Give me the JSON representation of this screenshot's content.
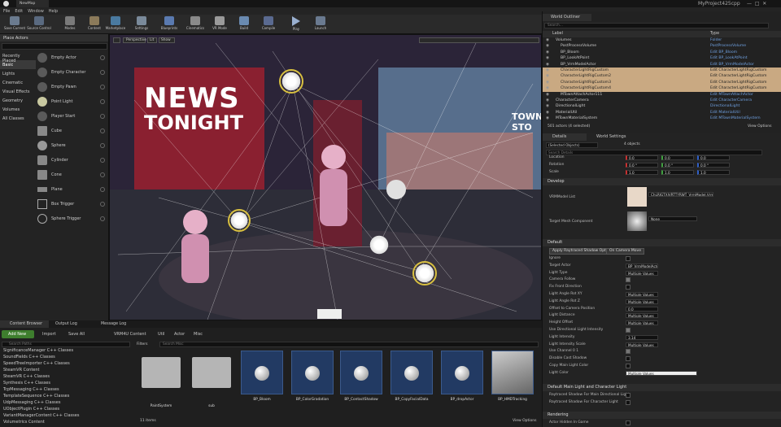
{
  "window": {
    "project": "MyProject425cpp",
    "tab": "NewMap"
  },
  "menu": [
    "File",
    "Edit",
    "Window",
    "Help"
  ],
  "toolbar": [
    "Save Current",
    "Source Control",
    "Modes",
    "Content",
    "Marketplace",
    "Settings",
    "Blueprints",
    "Cinematics",
    "VR Mode",
    "Build",
    "Compile",
    "Play",
    "Launch"
  ],
  "place_actors": {
    "tab": "Place Actors",
    "search_placeholder": "",
    "categories": [
      "Recently Placed",
      "Basic",
      "Lights",
      "Cinematic",
      "Visual Effects",
      "Geometry",
      "Volumes",
      "All Classes"
    ],
    "actors": [
      "Empty Actor",
      "Empty Character",
      "Empty Pawn",
      "Point Light",
      "Player Start",
      "Cube",
      "Sphere",
      "Cylinder",
      "Cone",
      "Plane",
      "Box Trigger",
      "Sphere Trigger"
    ]
  },
  "viewport": {
    "perspective": "Perspective",
    "lit": "Lit",
    "show": "Show",
    "sign_line1": "NEWS",
    "sign_line2": "TONIGHT",
    "side_sign": "TOWN STO"
  },
  "content_browser": {
    "tabs": [
      "Content Browser",
      "Output Log",
      "Message Log"
    ],
    "add_new": "Add New",
    "import": "Import",
    "save_all": "Save All",
    "path": [
      "VRM4U Content",
      "Util",
      "Actor",
      "Misc"
    ],
    "search_paths": "Search Paths",
    "filters": "Filters",
    "search_misc": "Search Misc",
    "tree": [
      "SignificanceManager C++ Classes",
      "SoundFields C++ Classes",
      "SpeedTreeImporter C++ Classes",
      "SteamVR Content",
      "SteamVR C++ Classes",
      "Synthesis C++ Classes",
      "TcpMessaging C++ Classes",
      "TemplateSequence C++ Classes",
      "UdpMessaging C++ Classes",
      "UObjectPlugin C++ Classes",
      "VariantManagerContent C++ Classes",
      "Volumetrics Content"
    ],
    "assets": [
      "PaintSystem",
      "sub",
      "BP_Bloom",
      "BP_ColorGradation",
      "BP_ContactShadow",
      "BP_CopyFacialData",
      "BP_dropActor",
      "BP_HMDTracking"
    ],
    "count": "11 items",
    "view_options": "View Options"
  },
  "outliner": {
    "tab": "World Outliner",
    "search_placeholder": "Search...",
    "col_label": "Label",
    "col_type": "Type",
    "rows": [
      {
        "label": "Volumes",
        "type": "Folder"
      },
      {
        "label": "PostProcessVolume",
        "type": "PostProcessVolume"
      },
      {
        "label": "BP_Bloom",
        "type": "Edit BP_Bloom"
      },
      {
        "label": "BP_LookAtPoint",
        "type": "Edit BP_LookAtPoint"
      },
      {
        "label": "BP_VrmModelActor",
        "type": "Edit BP_VrmModelActor"
      },
      {
        "label": "CharacterLightRigCustom",
        "type": "Edit CharacterLightRigCustom"
      },
      {
        "label": "CharacterLightRigCustom2",
        "type": "Edit CharacterLightRigCustom"
      },
      {
        "label": "CharacterLightRigCustom3",
        "type": "Edit CharacterLightRigCustom"
      },
      {
        "label": "CharacterLightRigCustom4",
        "type": "Edit CharacterLightRigCustom"
      },
      {
        "label": "MTownAttachActor111",
        "type": "Edit MTownAttachActor"
      },
      {
        "label": "CharacterCamera",
        "type": "Edit CharacterCamera"
      },
      {
        "label": "DirectionalLight",
        "type": "DirectionalLight"
      },
      {
        "label": "MaterialUtil",
        "type": "Edit MaterialUtil"
      },
      {
        "label": "MTownMaterialSystem",
        "type": "Edit MTownMaterialSystem"
      }
    ],
    "status": "501 actors (4 selected)",
    "view_options": "View Options"
  },
  "details": {
    "tabs": [
      "Details",
      "World Settings"
    ],
    "selected": "(Selected Objects)",
    "count": "4 objects",
    "search_placeholder": "Search Details",
    "transform": [
      {
        "label": "Location",
        "x": "0.0",
        "y": "0.0",
        "z": "0.0"
      },
      {
        "label": "Rotation",
        "x": "0.0 °",
        "y": "0.0 °",
        "z": "0.0 °"
      },
      {
        "label": "Scale",
        "x": "1.0",
        "y": "1.0",
        "z": "1.0"
      }
    ],
    "develop": "Develop",
    "vrm_model_list": "VRMModel List",
    "vrm_model_value": "ChLRIGTXIVRTTYRWT_VrmModel.VrmModel",
    "target_mesh": "Target Mesh Component",
    "target_mesh_value": "None",
    "default": "Default",
    "apply_button": "Apply Raytraced Shadow Option",
    "camera_move_button": "On Camera Move",
    "props": [
      {
        "label": "Ignore",
        "kind": "check",
        "on": false
      },
      {
        "label": "Target Actor",
        "kind": "value",
        "value": "BP_VrmModelActor"
      },
      {
        "label": "Light Type",
        "kind": "value",
        "value": "Multiple Values"
      },
      {
        "label": "Camera Follow",
        "kind": "check",
        "on": true
      },
      {
        "label": "Fix Front Direction",
        "kind": "check",
        "on": false
      },
      {
        "label": "Light Angle Rot XY",
        "kind": "value",
        "value": "Multiple Values"
      },
      {
        "label": "Light Angle Rot Z",
        "kind": "value",
        "value": "Multiple Values"
      },
      {
        "label": "Offset to Camera Position",
        "kind": "value",
        "value": "0.0"
      },
      {
        "label": "Light Distance",
        "kind": "value",
        "value": "Multiple Values"
      },
      {
        "label": "Height Offset",
        "kind": "value",
        "value": "Multiple Values"
      },
      {
        "label": "Use Directional Light Intensity",
        "kind": "check",
        "on": true
      },
      {
        "label": "Light Intensity",
        "kind": "value",
        "value": "3.14"
      },
      {
        "label": "Light Intensity Scale",
        "kind": "value",
        "value": "Multiple Values"
      },
      {
        "label": "Use Channel 0 1",
        "kind": "check",
        "on": true
      },
      {
        "label": "Disable Cast Shadow",
        "kind": "check",
        "on": false
      },
      {
        "label": "Copy Main Light Color",
        "kind": "check",
        "on": false
      },
      {
        "label": "Light Color",
        "kind": "value",
        "value": "Multiple Values"
      }
    ],
    "section_main_light": "Default Main Light and Character Light",
    "raytrace_props": [
      "Raytraced Shadow For Main Directional Light",
      "Raytraced Shadow For Character Light"
    ],
    "rendering": "Rendering",
    "actor_hidden": "Actor Hidden In Game"
  }
}
